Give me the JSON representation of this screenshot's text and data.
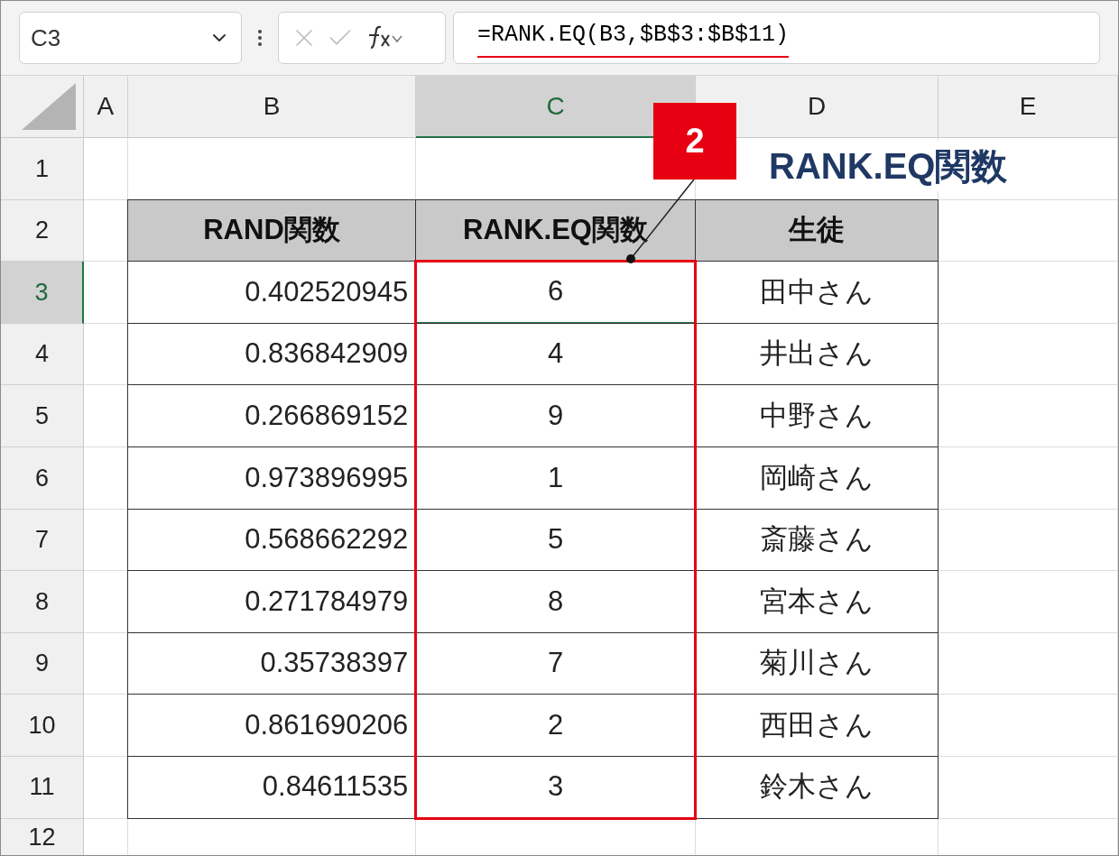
{
  "formula_bar": {
    "name_box": "C3",
    "formula": "=RANK.EQ(B3,$B$3:$B$11)",
    "formula_underlined": true
  },
  "columns": [
    {
      "label": "A",
      "selected": false
    },
    {
      "label": "B",
      "selected": false
    },
    {
      "label": "C",
      "selected": true
    },
    {
      "label": "D",
      "selected": false
    },
    {
      "label": "E",
      "selected": false
    }
  ],
  "row_headers": [
    {
      "label": "1",
      "selected": false
    },
    {
      "label": "2",
      "selected": false
    },
    {
      "label": "3",
      "selected": true
    },
    {
      "label": "4",
      "selected": false
    },
    {
      "label": "5",
      "selected": false
    },
    {
      "label": "6",
      "selected": false
    },
    {
      "label": "7",
      "selected": false
    },
    {
      "label": "8",
      "selected": false
    },
    {
      "label": "9",
      "selected": false
    },
    {
      "label": "10",
      "selected": false
    },
    {
      "label": "11",
      "selected": false
    },
    {
      "label": "12",
      "selected": false
    }
  ],
  "table": {
    "header": [
      "RAND関数",
      "RANK.EQ関数",
      "生徒"
    ],
    "rows": [
      {
        "value": "0.402520945",
        "rank": "6",
        "student": "田中さん"
      },
      {
        "value": "0.836842909",
        "rank": "4",
        "student": "井出さん"
      },
      {
        "value": "0.266869152",
        "rank": "9",
        "student": "中野さん"
      },
      {
        "value": "0.973896995",
        "rank": "1",
        "student": "岡崎さん"
      },
      {
        "value": "0.568662292",
        "rank": "5",
        "student": "斎藤さん"
      },
      {
        "value": "0.271784979",
        "rank": "8",
        "student": "宮本さん"
      },
      {
        "value": "0.35738397",
        "rank": "7",
        "student": "菊川さん"
      },
      {
        "value": "0.861690206",
        "rank": "2",
        "student": "西田さん"
      },
      {
        "value": "0.84611535",
        "rank": "3",
        "student": "鈴木さん"
      }
    ]
  },
  "callout": {
    "number": "2",
    "label": "RANK.EQ関数"
  }
}
